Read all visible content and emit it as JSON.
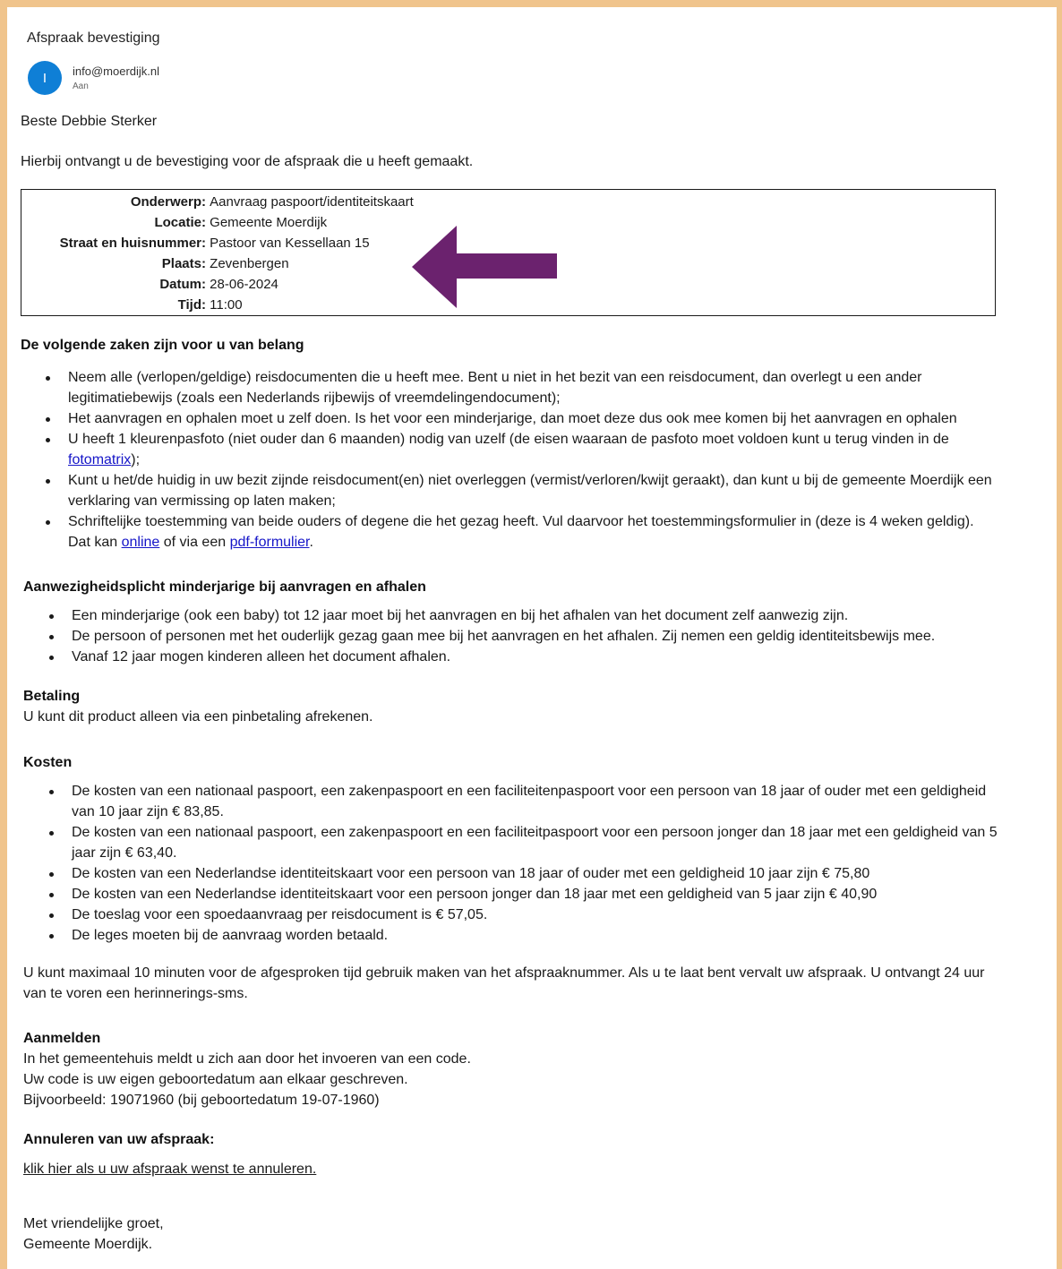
{
  "email": {
    "subject": "Afspraak bevestiging",
    "avatar_initial": "I",
    "sender": "info@moerdijk.nl",
    "recipient_label": "Aan"
  },
  "greeting": "Beste Debbie Sterker",
  "intro": "Hierbij ontvangt u de bevestiging voor de afspraak die u heeft gemaakt.",
  "appointment": [
    {
      "label": "Onderwerp:",
      "value": "Aanvraag paspoort/identiteitskaart"
    },
    {
      "label": "Locatie:",
      "value": "Gemeente Moerdijk"
    },
    {
      "label": "Straat en huisnummer:",
      "value": "Pastoor van Kessellaan 15"
    },
    {
      "label": "Plaats:",
      "value": "Zevenbergen"
    },
    {
      "label": "Datum:",
      "value": "28-06-2024"
    },
    {
      "label": "Tijd:",
      "value": "11:00"
    }
  ],
  "arrow_color": "#6b226e",
  "important": {
    "heading": "De volgende zaken zijn voor u van belang",
    "items": [
      "Neem alle (verlopen/geldige) reisdocumenten die u heeft mee. Bent u niet in het bezit van een reisdocument, dan overlegt u een ander legitimatiebewijs (zoals een Nederlands rijbewijs of vreemdelingendocument);",
      "Het aanvragen en ophalen moet u zelf doen. Is het voor een minderjarige, dan moet deze dus ook mee komen bij het aanvragen en ophalen",
      "U heeft 1 kleurenpasfoto (niet ouder dan 6 maanden) nodig van uzelf (de eisen waaraan de pasfoto moet voldoen kunt u terug vinden in de ",
      "Kunt u het/de huidig in uw bezit zijnde reisdocument(en) niet overleggen (vermist/verloren/kwijt geraakt), dan kunt u bij de gemeente Moerdijk een verklaring van vermissing op laten maken;",
      "Schriftelijke toestemming van beide ouders of degene die het gezag heeft. Vul daarvoor het toestemmingsformulier in (deze is 4 weken geldig). Dat kan "
    ],
    "fotomatrix_link": "fotomatrix",
    "item3_suffix": ");",
    "online_link": "online",
    "item5_mid": " of via een ",
    "pdf_link": "pdf-formulier",
    "item5_suffix": "."
  },
  "presence": {
    "heading": "Aanwezigheidsplicht minderjarige bij aanvragen en afhalen",
    "items": [
      "Een minderjarige (ook een baby) tot 12 jaar moet bij het aanvragen en bij het afhalen van het document zelf aanwezig zijn.",
      "De persoon of personen met het ouderlijk gezag gaan mee bij het aanvragen en het afhalen. Zij nemen een geldig identiteitsbewijs mee.",
      "Vanaf 12 jaar mogen kinderen alleen het document afhalen."
    ]
  },
  "payment": {
    "heading": "Betaling",
    "text": "U kunt dit product alleen via een pinbetaling afrekenen."
  },
  "costs": {
    "heading": "Kosten",
    "items": [
      "De kosten van een nationaal paspoort, een zakenpaspoort en een faciliteitenpaspoort voor een persoon van 18 jaar of ouder met een geldigheid van 10 jaar zijn € 83,85.",
      "De kosten van een nationaal paspoort, een zakenpaspoort en een faciliteitpaspoort voor een persoon jonger dan 18 jaar met een geldigheid van 5 jaar zijn € 63,40.",
      "De kosten van een Nederlandse identiteitskaart voor een persoon van 18 jaar of ouder met een geldigheid 10 jaar zijn € 75,80",
      "De kosten van een Nederlandse identiteitskaart voor een persoon jonger dan 18 jaar met een geldigheid van 5 jaar zijn € 40,90",
      "De toeslag voor een spoedaanvraag per reisdocument is € 57,05.",
      "De leges moeten bij de aanvraag worden betaald."
    ]
  },
  "notice": "U kunt maximaal 10 minuten voor de afgesproken tijd gebruik maken van het afspraaknummer. Als u te laat bent vervalt uw afspraak. U ontvangt 24 uur van te voren een herinnerings-sms.",
  "signin": {
    "heading": "Aanmelden",
    "lines": [
      "In het gemeentehuis meldt u zich aan door het invoeren van een code.",
      "Uw code is uw eigen geboortedatum aan elkaar geschreven.",
      "Bijvoorbeeld: 19071960 (bij geboortedatum 19-07-1960)"
    ]
  },
  "cancel": {
    "heading": "Annuleren van uw afspraak:",
    "link": "klik hier als u uw afspraak wenst te annuleren."
  },
  "closing": [
    "Met vriendelijke groet,",
    "Gemeente Moerdijk."
  ]
}
